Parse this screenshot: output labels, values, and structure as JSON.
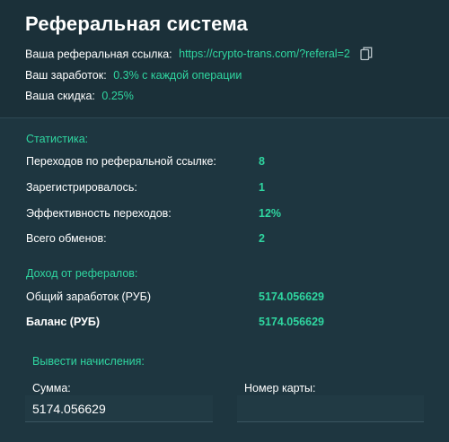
{
  "header": {
    "title": "Реферальная система",
    "ref_link_label": "Ваша реферальная ссылка:",
    "ref_link_value": "https://crypto-trans.com/?referal=2",
    "earnings_label": "Ваш заработок:",
    "earnings_value": "0.3% с каждой операции",
    "discount_label": "Ваша скидка:",
    "discount_value": "0.25%"
  },
  "stats": {
    "section_title": "Статистика:",
    "items": [
      {
        "label": "Переходов по реферальной ссылке:",
        "value": "8"
      },
      {
        "label": "Зарегистрировалось:",
        "value": "1"
      },
      {
        "label": "Эффективность переходов:",
        "value": "12%"
      },
      {
        "label": "Всего обменов:",
        "value": "2"
      }
    ]
  },
  "income": {
    "section_title": "Доход от рефералов:",
    "total_label": "Общий заработок (РУБ)",
    "total_value": "5174.056629",
    "balance_label": "Баланс (РУБ)",
    "balance_value": "5174.056629"
  },
  "withdraw": {
    "section_title": "Вывести начисления:",
    "amount_label": "Сумма:",
    "amount_value": "5174.056629",
    "card_label": "Номер карты:",
    "card_value": ""
  },
  "colors": {
    "background": "#1b3039",
    "accent": "#2fd6a0"
  }
}
